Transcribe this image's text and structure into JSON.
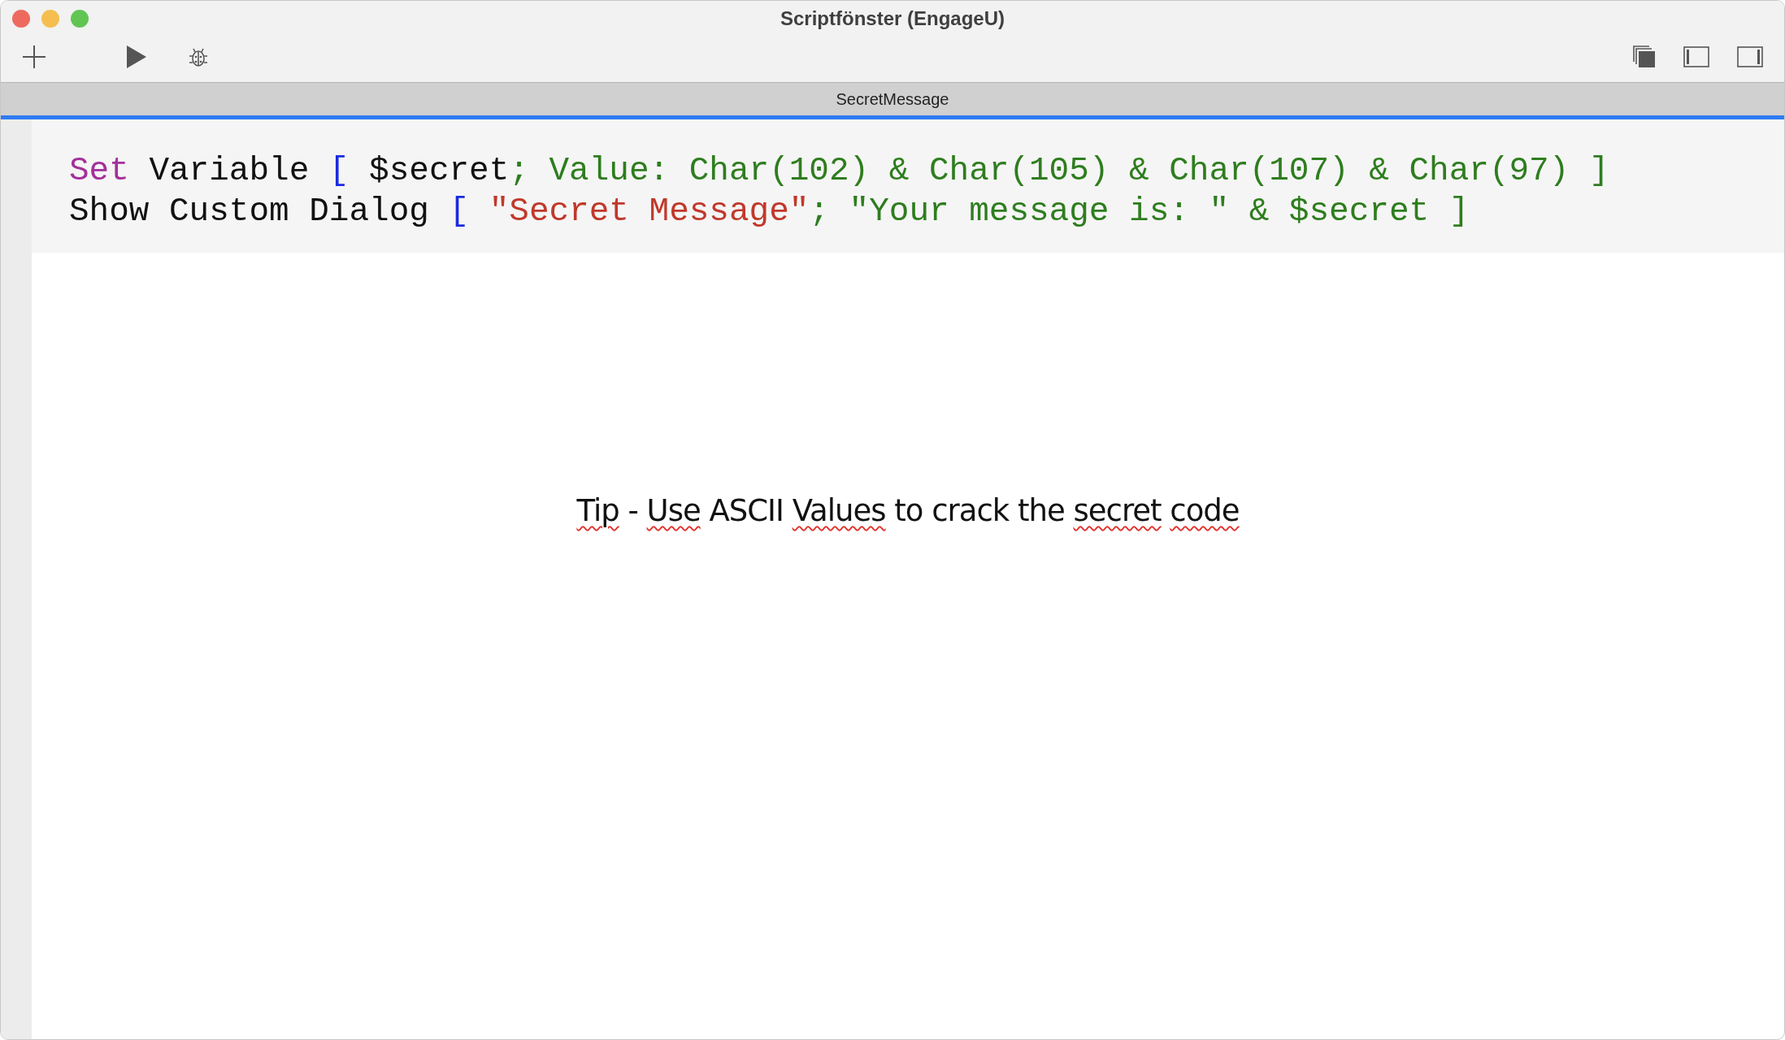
{
  "window": {
    "title": "Scriptfönster (EngageU)"
  },
  "tab": {
    "label": "SecretMessage"
  },
  "script_lines": [
    {
      "tokens": [
        {
          "kind": "keyword",
          "text": "Set"
        },
        {
          "kind": "plain",
          "text": " Variable "
        },
        {
          "kind": "bracket",
          "text": "["
        },
        {
          "kind": "plain",
          "text": " $secret"
        },
        {
          "kind": "param",
          "text": "; Value: Char(102) & Char(105) & Char(107) & Char(97) ]"
        }
      ]
    },
    {
      "tokens": [
        {
          "kind": "plain",
          "text": "Show Custom Dialog "
        },
        {
          "kind": "bracket",
          "text": "["
        },
        {
          "kind": "string",
          "text": " \"Secret Message\""
        },
        {
          "kind": "param",
          "text": "; \"Your message is: \" & $secret ]"
        }
      ]
    }
  ],
  "tip": {
    "words": [
      {
        "text": "Tip",
        "flagged": true
      },
      {
        "text": "-",
        "flagged": false
      },
      {
        "text": "Use",
        "flagged": true
      },
      {
        "text": "ASCII",
        "flagged": false
      },
      {
        "text": "Values",
        "flagged": true
      },
      {
        "text": "to",
        "flagged": false
      },
      {
        "text": "crack",
        "flagged": false
      },
      {
        "text": "the",
        "flagged": false
      },
      {
        "text": "secret",
        "flagged": true
      },
      {
        "text": "code",
        "flagged": true
      }
    ]
  }
}
